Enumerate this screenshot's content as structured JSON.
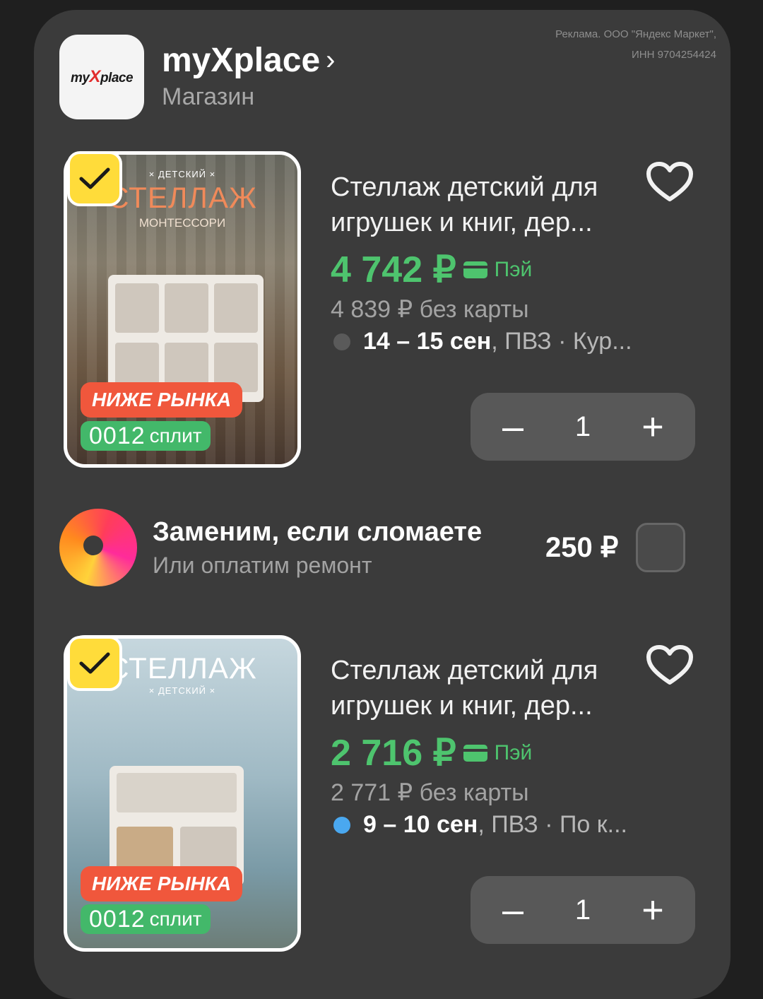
{
  "ad_note": "Реклама. ООО \"Яндекс Маркет\", ИНН 9704254424",
  "shop": {
    "logo_text_pre": "my",
    "logo_text_x": "X",
    "logo_text_post": "place",
    "name": "myXplace",
    "chevron": "›",
    "type": "Магазин"
  },
  "products": [
    {
      "image_small": "× ДЕТСКИЙ ×",
      "image_big": "СТЕЛЛАЖ",
      "image_sub": "МОНТЕССОРИ",
      "badge_lower": "НИЖЕ РЫНКА",
      "split_num": "0012",
      "split_label": "сплит",
      "title": "Стеллаж детский для игрушек и книг, дер...",
      "price": "4 742 ₽",
      "pay_label": "Пэй",
      "old_price": "4 839 ₽ без карты",
      "delivery_date": "14 – 15 сен",
      "delivery_rest": ", ПВЗ · Кур...",
      "dot_color": "#5a5a5a",
      "qty": "1",
      "minus": "–",
      "plus": "+",
      "checked": true
    },
    {
      "image_big": "СТЕЛЛАЖ",
      "image_small": "× ДЕТСКИЙ ×",
      "badge_lower": "НИЖЕ РЫНКА",
      "split_num": "0012",
      "split_label": "сплит",
      "title": "Стеллаж детский для игрушек и книг, дер...",
      "price": "2 716 ₽",
      "pay_label": "Пэй",
      "old_price": "2 771 ₽ без карты",
      "delivery_date": "9 – 10 сен",
      "delivery_rest": ", ПВЗ · По к...",
      "dot_color": "#4aa8f0",
      "qty": "1",
      "minus": "–",
      "plus": "+",
      "checked": true
    }
  ],
  "insurance": {
    "title": "Заменим, если сломаете",
    "subtitle": "Или оплатим ремонт",
    "price": "250 ₽",
    "checked": false
  },
  "colors": {
    "accent_green": "#4ec46e",
    "badge_yellow": "#ffdc3a",
    "tag_red": "#f0573c",
    "card_bg": "#3b3b3b"
  }
}
